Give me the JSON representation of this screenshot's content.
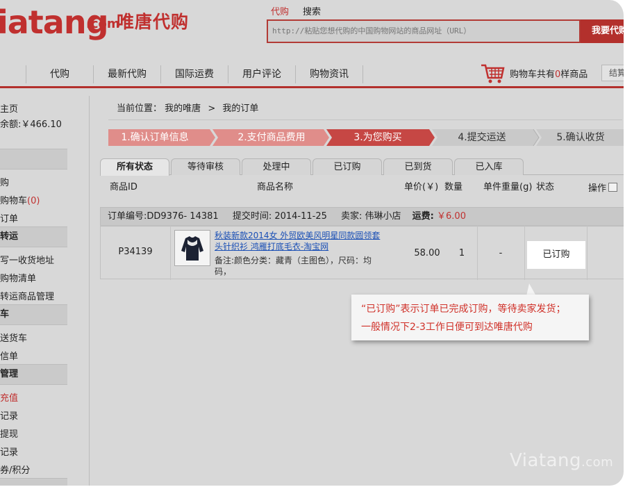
{
  "header": {
    "logo_text": "iatang",
    "logo_dotcom": ".com",
    "logo_cn": "唯唐代购",
    "search_tabs": [
      "代购",
      "搜索"
    ],
    "search_placeholder": "http://粘贴您想代购的中国购物网站的商品网址（URL）",
    "search_button": "我要代购"
  },
  "nav": {
    "items": [
      "",
      "代购",
      "最新代购",
      "国际运费",
      "用户评论",
      "购物资讯"
    ],
    "cart_text_prefix": "购物车共有",
    "cart_count": "0",
    "cart_text_suffix": "样商品",
    "checkout_button": "结算"
  },
  "sidebar": {
    "home": "主页",
    "balance": "余额:￥466.10",
    "section1_items": [
      "购",
      "购物车",
      "订单"
    ],
    "cart_badge": "(0)",
    "section2_title": "转运",
    "section2_items": [
      "写一收货地址",
      "购物清单",
      "转运商品管理"
    ],
    "section3_title": "车",
    "section3_items": [
      "送货车",
      "信单"
    ],
    "section4_title": "管理",
    "section4_items": [
      "充值",
      "记录",
      "提现",
      "记录",
      "券/积分"
    ]
  },
  "breadcrumb": {
    "label": "当前位置：",
    "path1": "我的唯唐",
    "sep": ">",
    "path2": "我的订单"
  },
  "steps": [
    "1.确认订单信息",
    "2.支付商品费用",
    "3.为您购买",
    "4.提交运送",
    "5.确认收货"
  ],
  "tabs": [
    "所有状态",
    "等待审核",
    "处理中",
    "已订购",
    "已到货",
    "已入库"
  ],
  "table_headers": {
    "id": "商品ID",
    "name": "商品名称",
    "price": "单价(￥)",
    "qty": "数量",
    "weight": "单件重量(g)",
    "status": "状态",
    "action": "操作"
  },
  "order": {
    "number_label": "订单编号:DD9376- 14381",
    "time_label": "提交时间: 2014-11-25",
    "seller_label": "卖家: 伟琳小店",
    "shipping_label": "运费:",
    "shipping_value": "￥6.00",
    "product_id": "P34139",
    "product_name": "秋装新款2014女 外贸欧美风明星同款圆领套头针织衫 鸿雁打底毛衣-淘宝网",
    "remark": "备注:颜色分类：藏青（主图色），尺码：均码，",
    "price": "58.00",
    "qty": "1",
    "weight": "-",
    "status": "已订购"
  },
  "callout": {
    "line1": "“已订购”表示订单已完成订购，等待卖家发货；",
    "line2": "一般情况下2-3工作日便可到达唯唐代购"
  },
  "watermark": {
    "main": "Viatang",
    "suffix": ".com"
  },
  "colors": {
    "brand_red": "#c0302f",
    "step_active": "#c64744",
    "step_done": "#e08d8a",
    "step_pending": "#c9c9c9"
  }
}
